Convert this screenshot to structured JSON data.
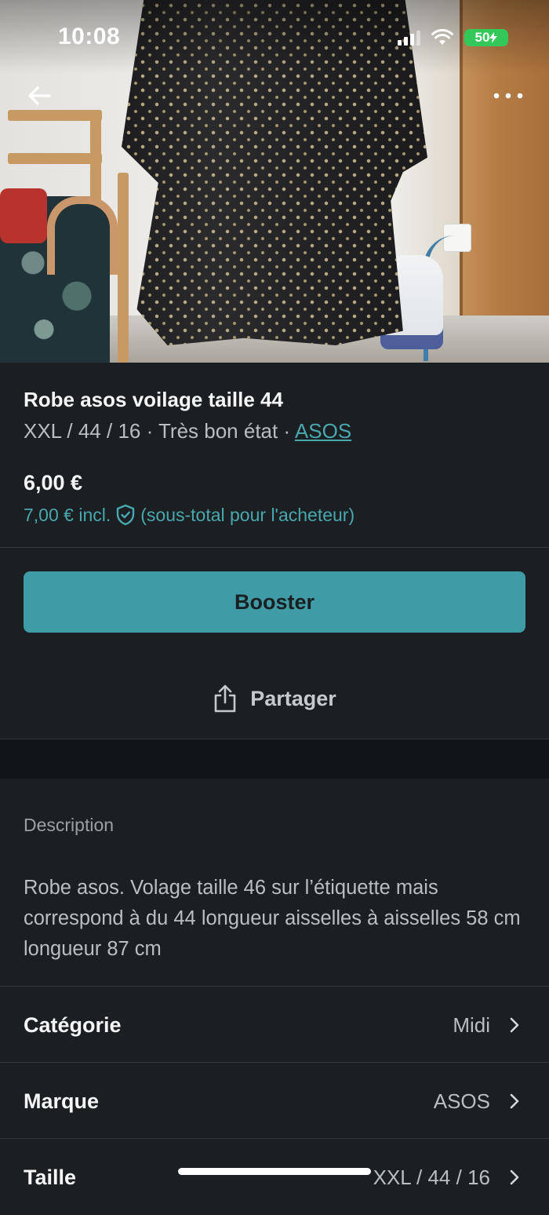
{
  "status_bar": {
    "time": "10:08",
    "battery": "50",
    "battery_color": "#34c759"
  },
  "nav": {
    "back_icon": "arrow-left-icon",
    "more_icon": "ellipsis-icon"
  },
  "item": {
    "title": "Robe asos voilage taille 44",
    "details_prefix": "XXL / 44 / 16 · Très bon état · ",
    "brand_link": "ASOS",
    "price": "6,00 €",
    "price_incl_amount": "7,00 € incl.",
    "price_incl_note": "(sous-total pour l'acheteur)"
  },
  "actions": {
    "booster_label": "Booster",
    "share_label": "Partager"
  },
  "description": {
    "label": "Description",
    "text": "Robe asos. Volage taille 46 sur l’étiquette mais correspond à du 44 longueur aisselles à aisselles 58 cm longueur 87 cm"
  },
  "attributes": [
    {
      "label": "Catégorie",
      "value": "Midi"
    },
    {
      "label": "Marque",
      "value": "ASOS"
    },
    {
      "label": "Taille",
      "value": "XXL / 44 / 16"
    }
  ],
  "colors": {
    "accent": "#3f9ba6",
    "link": "#49a7b0",
    "background": "#1b1f21"
  }
}
